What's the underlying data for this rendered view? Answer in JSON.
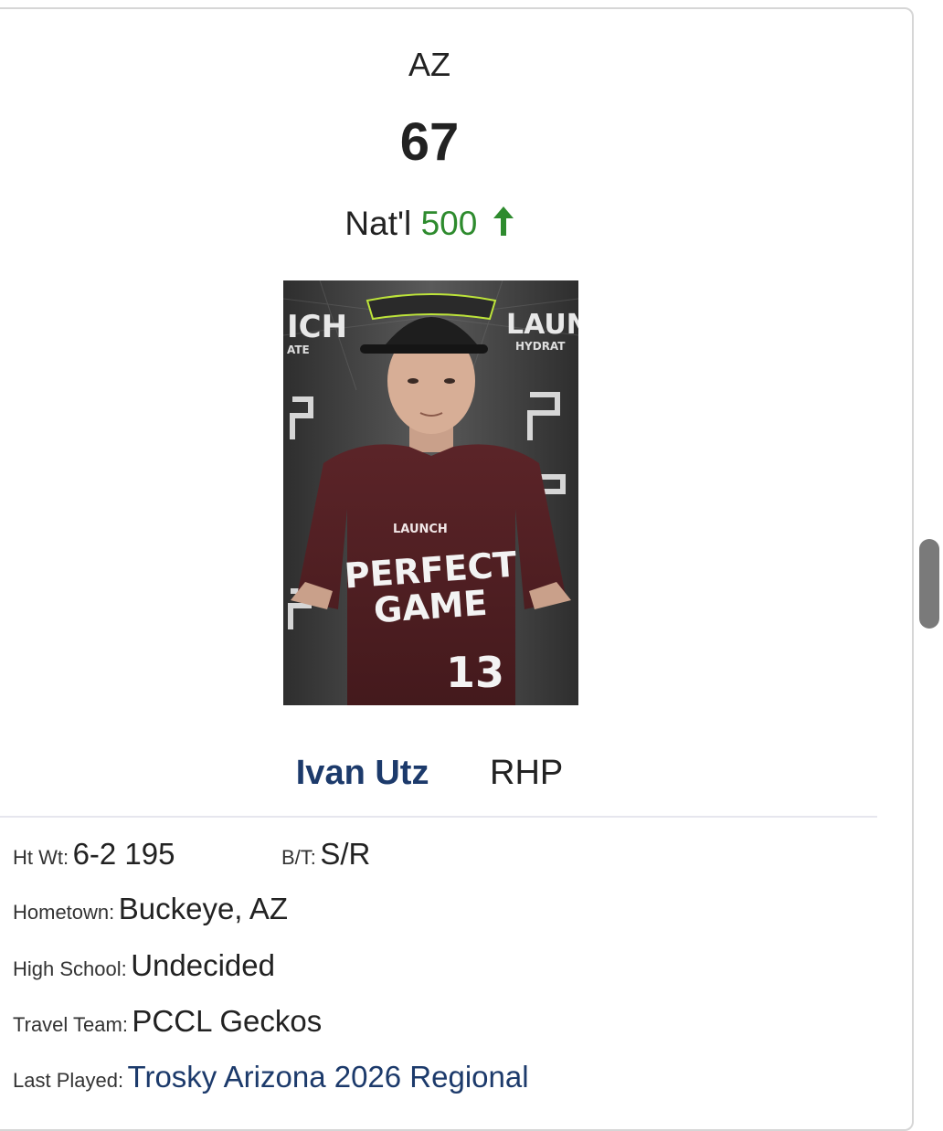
{
  "card": {
    "state": "AZ",
    "state_rank": "67",
    "natl_label": "Nat'l",
    "natl_rank": "500",
    "natl_trend": "up",
    "colors": {
      "trend_green": "#2e8b2e",
      "name_blue": "#1c3a6b"
    }
  },
  "photo": {
    "backdrop_text_left": "ICH",
    "backdrop_text_left_sub": "ATE",
    "backdrop_text_right": "LAUN",
    "backdrop_text_right_sub": "HYDRAT",
    "shirt_brand": "LAUNCH",
    "shirt_line1": "PERFECT",
    "shirt_line2": "GAME",
    "jersey_number": "13"
  },
  "player": {
    "name": "Ivan Utz",
    "position": "RHP"
  },
  "details": {
    "htwt_label": "Ht Wt:",
    "htwt_value": "6-2 195",
    "bt_label": "B/T:",
    "bt_value": "S/R",
    "hometown_label": "Hometown:",
    "hometown_value": "Buckeye, AZ",
    "highschool_label": "High School:",
    "highschool_value": "Undecided",
    "travelteam_label": "Travel Team:",
    "travelteam_value": "PCCL Geckos",
    "lastplayed_label": "Last Played:",
    "lastplayed_value": "Trosky Arizona 2026 Regional"
  }
}
